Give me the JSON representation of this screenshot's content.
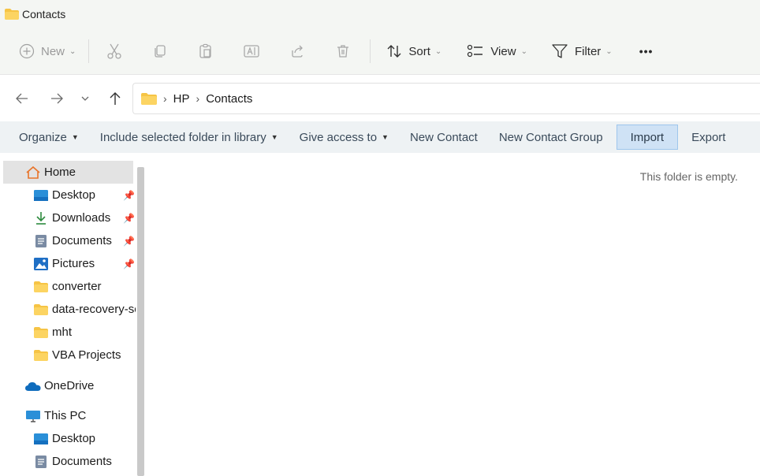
{
  "window": {
    "title": "Contacts"
  },
  "commandbar": {
    "new_label": "New",
    "sort_label": "Sort",
    "view_label": "View",
    "filter_label": "Filter",
    "more_label": "•••"
  },
  "address": {
    "crumbs": [
      "HP",
      "Contacts"
    ]
  },
  "ribbon": {
    "organize": "Organize",
    "include": "Include selected folder in library",
    "give_access": "Give access to",
    "new_contact": "New Contact",
    "new_contact_group": "New Contact Group",
    "import": "Import",
    "export": "Export"
  },
  "nav": {
    "items": [
      {
        "label": "Home",
        "icon": "home-icon"
      },
      {
        "label": "Desktop",
        "icon": "desktop-folder-icon",
        "pinned": true
      },
      {
        "label": "Downloads",
        "icon": "download-icon",
        "pinned": true
      },
      {
        "label": "Documents",
        "icon": "documents-icon",
        "pinned": true
      },
      {
        "label": "Pictures",
        "icon": "pictures-icon",
        "pinned": true
      },
      {
        "label": "converter",
        "icon": "folder-icon"
      },
      {
        "label": "data-recovery-sc",
        "icon": "folder-icon"
      },
      {
        "label": "mht",
        "icon": "folder-icon"
      },
      {
        "label": "VBA Projects",
        "icon": "folder-icon"
      },
      {
        "label": "OneDrive",
        "icon": "onedrive-icon"
      },
      {
        "label": "This PC",
        "icon": "pc-icon"
      },
      {
        "label": "Desktop",
        "icon": "desktop-folder-icon"
      },
      {
        "label": "Documents",
        "icon": "documents-icon"
      }
    ]
  },
  "content": {
    "empty_message": "This folder is empty."
  },
  "colors": {
    "accent": "#0067c0",
    "folder": "#f6c445",
    "selected": "#cfe2f5"
  }
}
